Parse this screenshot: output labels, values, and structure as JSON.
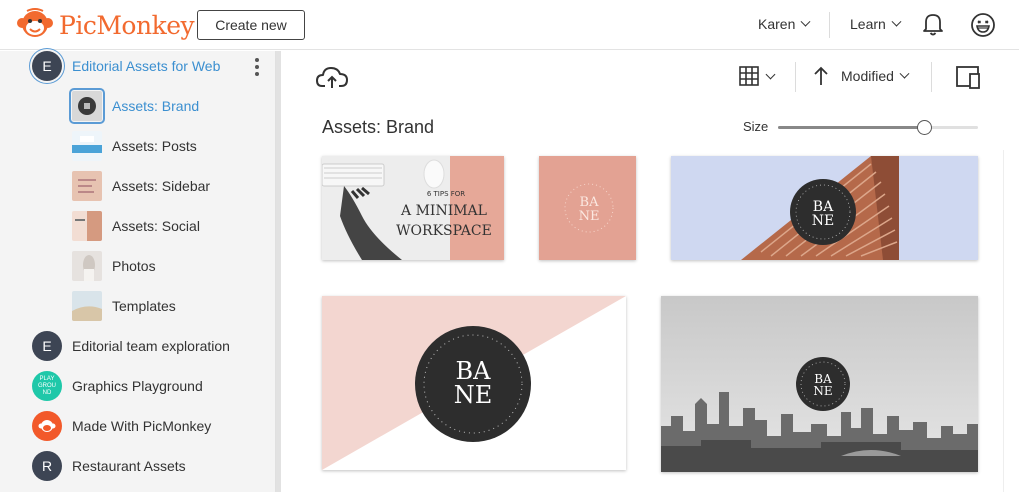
{
  "app": {
    "logo_text": "PicMonkey"
  },
  "header": {
    "create_label": "Create new",
    "user_label": "Karen",
    "learn_label": "Learn"
  },
  "sidebar": {
    "parent_folder": {
      "initial": "E",
      "label": "Editorial Assets for Web"
    },
    "subfolders": [
      {
        "label": "Assets: Brand"
      },
      {
        "label": "Assets: Posts"
      },
      {
        "label": "Assets: Sidebar"
      },
      {
        "label": "Assets: Social"
      },
      {
        "label": "Photos"
      },
      {
        "label": "Templates"
      }
    ],
    "folders": [
      {
        "initial": "E",
        "label": "Editorial team exploration"
      },
      {
        "initial": "PLAY GROU ND",
        "label": "Graphics Playground"
      },
      {
        "initial": "",
        "label": "Made With PicMonkey"
      },
      {
        "initial": "R",
        "label": "Restaurant Assets"
      }
    ]
  },
  "main": {
    "title": "Assets: Brand",
    "sort_label": "Modified",
    "size_label": "Size",
    "size_value": 0.73,
    "cards": [
      {
        "line1": "6 TIPS FOR",
        "line2": "A MINIMAL",
        "line3": "WORKSPACE"
      },
      {
        "logo_top": "BA",
        "logo_bottom": "NE"
      },
      {
        "logo_top": "BA",
        "logo_bottom": "NE"
      },
      {
        "logo_top": "BA",
        "logo_bottom": "NE"
      },
      {
        "logo_top": "BA",
        "logo_bottom": "NE"
      }
    ]
  },
  "colors": {
    "brand_orange": "#f26a2f",
    "accent_blue": "#3b8fd0",
    "folder_dark": "#3d4554",
    "playground_teal": "#1fc8a9",
    "made_with_orange": "#f2592a",
    "brand_pink": "#e3a293"
  },
  "icons": [
    "monkey-logo-icon",
    "chevron-down-icon",
    "bell-icon",
    "smiley-icon",
    "kebab-menu-icon",
    "cloud-upload-icon",
    "grid-view-icon",
    "sort-arrow-up-icon",
    "panel-toggle-icon"
  ]
}
